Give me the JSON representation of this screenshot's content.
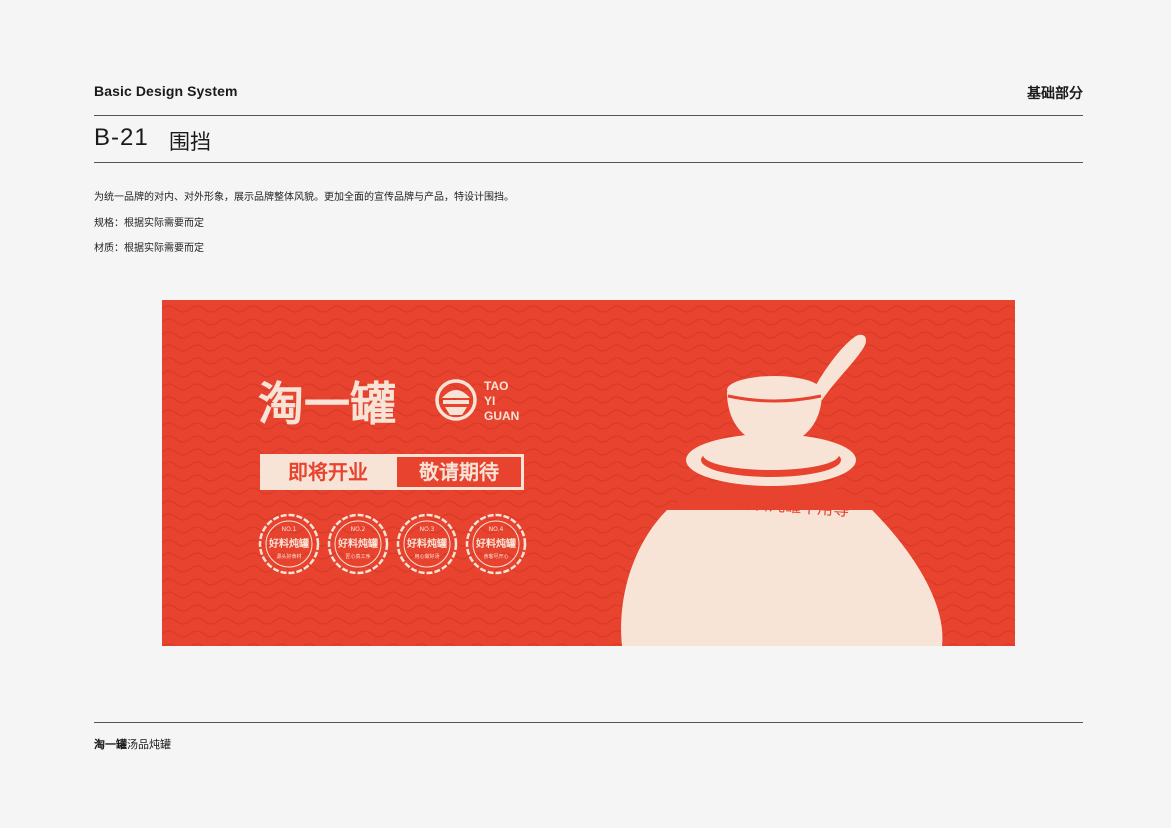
{
  "header": {
    "left": "Basic Design System",
    "right": "基础部分"
  },
  "section": {
    "code": "B-21",
    "title": "围挡"
  },
  "description": [
    "为统一品牌的对内、对外形象，展示品牌整体风貌。更加全面的宣传品牌与产品，特设计围挡。",
    "规格：根据实际需要而定",
    "材质：根据实际需要而定"
  ],
  "hoarding": {
    "brand_cn": "淘一罐",
    "brand_en": [
      "TAO",
      "YI",
      "GUAN"
    ],
    "slogan_left": "即将开业",
    "slogan_right": "敬请期待",
    "badges": [
      {
        "no": "NO.1",
        "title": "好料炖罐",
        "sub": "源头好食材"
      },
      {
        "no": "NO.2",
        "title": "好料炖罐",
        "sub": "匠心真工序"
      },
      {
        "no": "NO.3",
        "title": "好料炖罐",
        "sub": "用心做好汤"
      },
      {
        "no": "NO.4",
        "title": "好料炖罐",
        "sub": "食客尽开心"
      }
    ],
    "jar_text": "好料炖罐不用等",
    "colors": {
      "red": "#e8432f",
      "cream": "#f7e4d7"
    }
  },
  "footer": {
    "brand": "淘一罐",
    "rest": "汤品炖罐"
  }
}
